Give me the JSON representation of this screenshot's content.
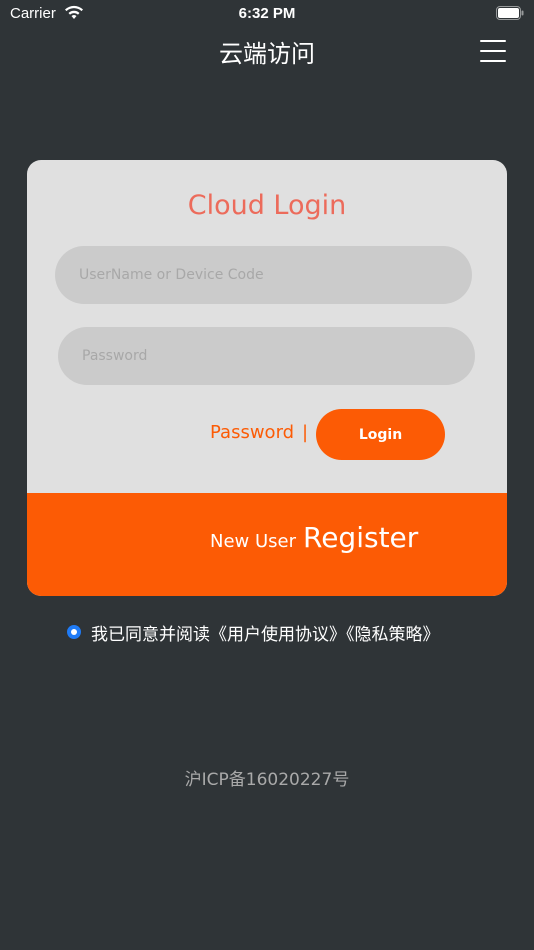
{
  "status_bar": {
    "carrier": "Carrier",
    "time": "6:32 PM"
  },
  "nav": {
    "title": "云端访问",
    "menu_icon": "hamburger-menu-icon"
  },
  "login_card": {
    "title": "Cloud Login",
    "username_placeholder": "UserName or Device Code",
    "password_placeholder": "Password",
    "forgot_label": "Password",
    "separator": "|",
    "login_label": "Login",
    "register_prefix": "New User",
    "register_label": "Register"
  },
  "agreement": {
    "text": "我已同意并阅读《用户使用协议》《隐私策略》",
    "checked": true
  },
  "footer": {
    "icp": "沪ICP备16020227号"
  },
  "colors": {
    "background": "#2f3437",
    "accent": "#fc5b05",
    "title": "#ec6b5b",
    "card": "#e0e0e0",
    "radio": "#1f7bf6"
  }
}
